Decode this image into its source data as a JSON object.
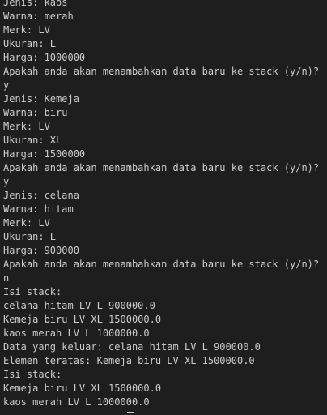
{
  "terminal": {
    "lines": [
      "Jenis: kaos",
      "Warna: merah",
      "Merk: LV",
      "Ukuran: L",
      "Harga: 1000000",
      "Apakah anda akan menambahkan data baru ke stack (y/n)?",
      "y",
      "Jenis: Kemeja",
      "Warna: biru",
      "Merk: LV",
      "Ukuran: XL",
      "Harga: 1500000",
      "Apakah anda akan menambahkan data baru ke stack (y/n)?",
      "y",
      "Jenis: celana",
      "Warna: hitam",
      "Merk: LV",
      "Ukuran: L",
      "Harga: 900000",
      "Apakah anda akan menambahkan data baru ke stack (y/n)?",
      "n",
      "Isi stack:",
      "celana hitam LV L 900000.0",
      "Kemeja biru LV XL 1500000.0",
      "kaos merah LV L 1000000.0",
      "Data yang keluar: celana hitam LV L 900000.0",
      "Elemen teratas: Kemeja biru LV XL 1500000.0",
      "Isi stack:",
      "Kemeja biru LV XL 1500000.0",
      "kaos merah LV L 1000000.0"
    ]
  }
}
